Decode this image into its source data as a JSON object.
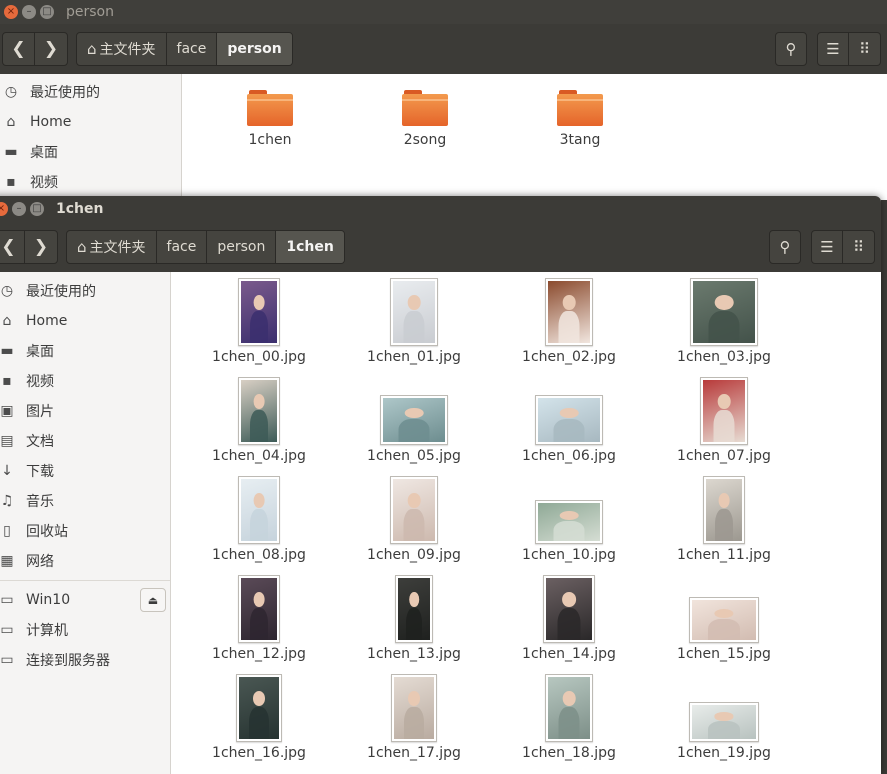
{
  "back_window": {
    "title": "person",
    "breadcrumbs": [
      "主文件夹",
      "face",
      "person"
    ],
    "sidebar": [
      {
        "label": "最近使用的",
        "icon": "clock-icon"
      },
      {
        "label": "Home",
        "icon": "home-icon"
      },
      {
        "label": "桌面",
        "icon": "folder-icon"
      },
      {
        "label": "视频",
        "icon": "video-icon"
      }
    ],
    "folders": [
      "1chen",
      "2song",
      "3tang"
    ]
  },
  "front_window": {
    "title": "1chen",
    "breadcrumbs": [
      "主文件夹",
      "face",
      "person",
      "1chen"
    ],
    "sidebar_places": [
      {
        "label": "最近使用的",
        "icon": "clock-icon"
      },
      {
        "label": "Home",
        "icon": "home-icon"
      },
      {
        "label": "桌面",
        "icon": "folder-icon"
      },
      {
        "label": "视频",
        "icon": "video-icon"
      },
      {
        "label": "图片",
        "icon": "image-icon"
      },
      {
        "label": "文档",
        "icon": "document-icon"
      },
      {
        "label": "下载",
        "icon": "download-icon"
      },
      {
        "label": "音乐",
        "icon": "music-icon"
      },
      {
        "label": "回收站",
        "icon": "trash-icon"
      },
      {
        "label": "网络",
        "icon": "network-icon"
      }
    ],
    "sidebar_devices": [
      {
        "label": "Win10",
        "icon": "drive-icon"
      },
      {
        "label": "计算机",
        "icon": "computer-icon"
      },
      {
        "label": "连接到服务器",
        "icon": "server-icon"
      }
    ],
    "files": [
      {
        "name": "1chen_00.jpg"
      },
      {
        "name": "1chen_01.jpg"
      },
      {
        "name": "1chen_02.jpg"
      },
      {
        "name": "1chen_03.jpg"
      },
      {
        "name": "1chen_04.jpg"
      },
      {
        "name": "1chen_05.jpg"
      },
      {
        "name": "1chen_06.jpg"
      },
      {
        "name": "1chen_07.jpg"
      },
      {
        "name": "1chen_08.jpg"
      },
      {
        "name": "1chen_09.jpg"
      },
      {
        "name": "1chen_10.jpg"
      },
      {
        "name": "1chen_11.jpg"
      },
      {
        "name": "1chen_12.jpg"
      },
      {
        "name": "1chen_13.jpg"
      },
      {
        "name": "1chen_14.jpg"
      },
      {
        "name": "1chen_15.jpg"
      },
      {
        "name": "1chen_16.jpg"
      },
      {
        "name": "1chen_17.jpg"
      },
      {
        "name": "1chen_18.jpg"
      },
      {
        "name": "1chen_19.jpg"
      }
    ]
  },
  "icons": {
    "back": "❮",
    "forward": "❯",
    "home": "⌂",
    "search": "⚲",
    "list": "☰",
    "grid": "⠿",
    "close": "×",
    "minimize": "–",
    "maximize": "□",
    "eject": "⏏"
  },
  "colors": {
    "titlebar": "#403f3b",
    "toolbar": "#3c3b37",
    "close_button": "#e66a3c",
    "folder": "#e5642a"
  }
}
